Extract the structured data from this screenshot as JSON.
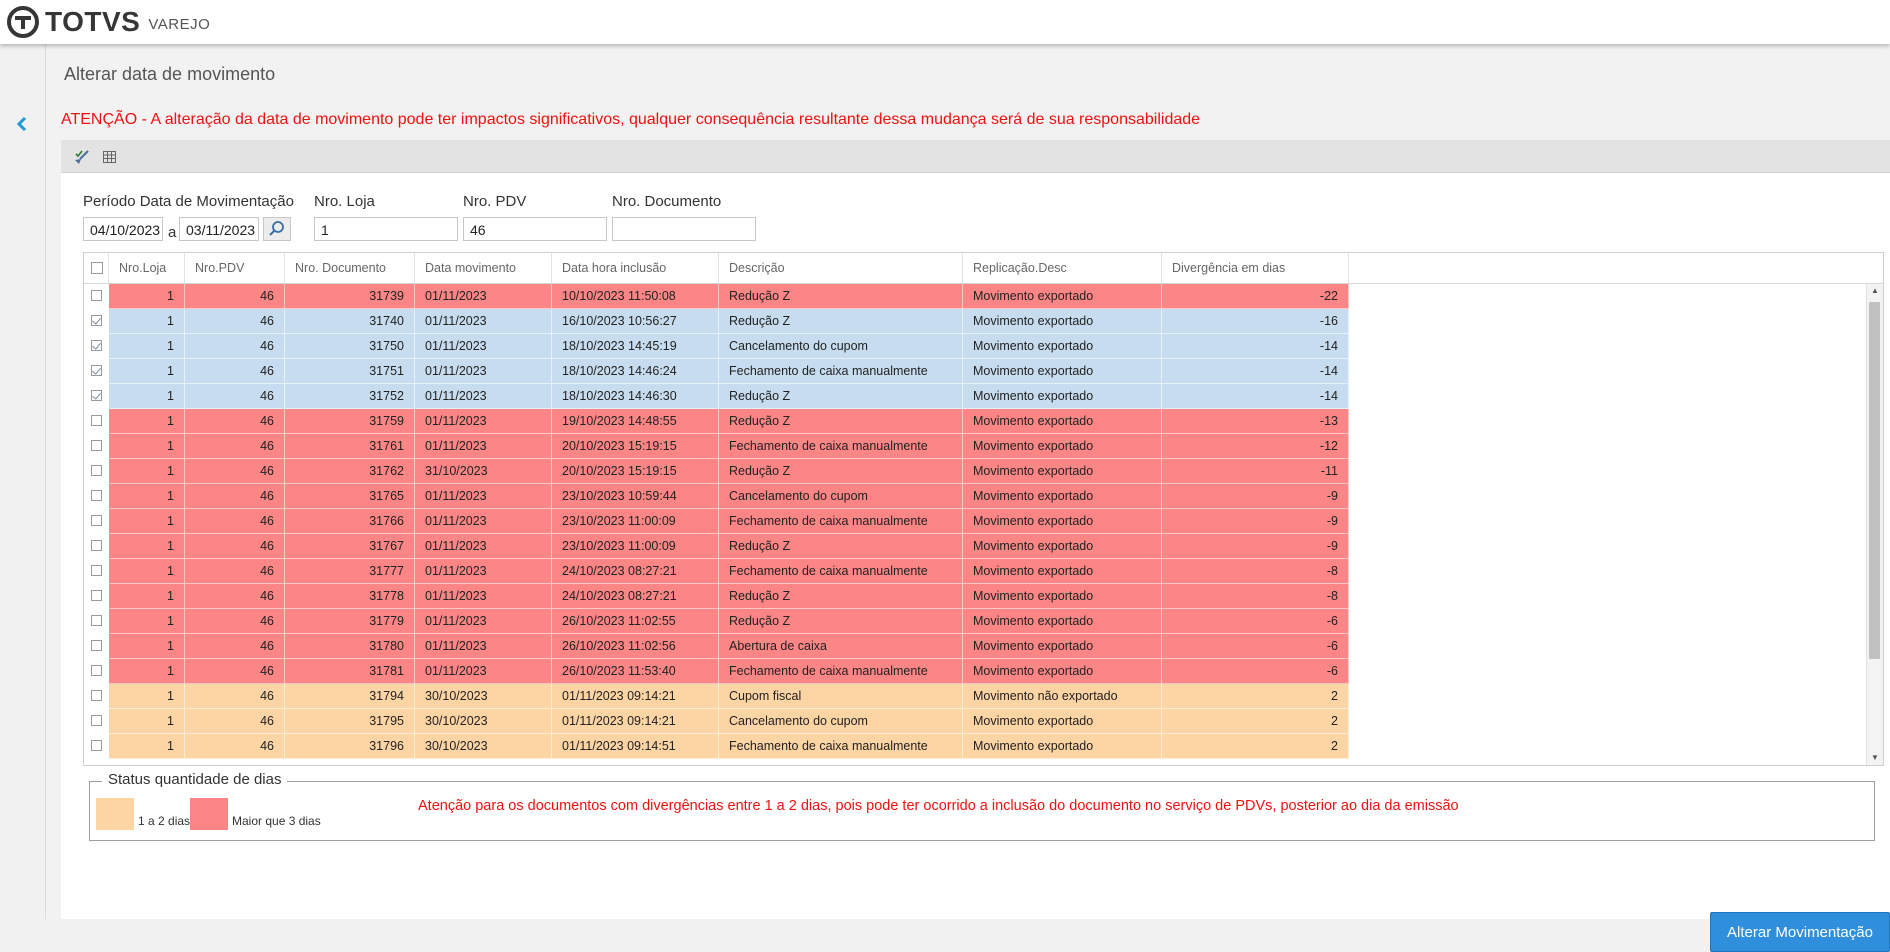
{
  "header": {
    "brand": "TOTVS",
    "product": "VAREJO"
  },
  "page": {
    "title": "Alterar data de movimento",
    "warning": "ATENÇÃO - A alteração da data de movimento pode ter impactos significativos, qualquer consequência resultante dessa mudança será de sua responsabilidade"
  },
  "filters": {
    "periodo_label": "Período Data de Movimentação",
    "data_inicio": "04/10/2023",
    "separator": "a",
    "data_fim": "03/11/2023",
    "loja_label": "Nro. Loja",
    "loja_value": "1",
    "pdv_label": "Nro. PDV",
    "pdv_value": "46",
    "documento_label": "Nro. Documento",
    "documento_value": ""
  },
  "colors": {
    "red": "#fc8585",
    "blue": "#c7ddef",
    "orange": "#fdd5a5",
    "warning": "#ee1111",
    "primary": "#2f8fdc"
  },
  "grid": {
    "columns": [
      {
        "key": "loja",
        "label": "Nro.Loja"
      },
      {
        "key": "pdv",
        "label": "Nro.PDV"
      },
      {
        "key": "doc",
        "label": "Nro. Documento"
      },
      {
        "key": "data",
        "label": "Data movimento"
      },
      {
        "key": "inclusao",
        "label": "Data hora inclusão"
      },
      {
        "key": "desc",
        "label": "Descrição"
      },
      {
        "key": "repl",
        "label": "Replicação.Desc"
      },
      {
        "key": "div",
        "label": "Divergência em dias"
      }
    ],
    "rows": [
      {
        "checked": false,
        "status": "red",
        "loja": "1",
        "pdv": "46",
        "doc": "31739",
        "data": "01/11/2023",
        "inclusao": "10/10/2023 11:50:08",
        "desc": "Redução Z",
        "repl": "Movimento exportado",
        "div": "-22"
      },
      {
        "checked": true,
        "status": "blue",
        "loja": "1",
        "pdv": "46",
        "doc": "31740",
        "data": "01/11/2023",
        "inclusao": "16/10/2023 10:56:27",
        "desc": "Redução Z",
        "repl": "Movimento exportado",
        "div": "-16"
      },
      {
        "checked": true,
        "status": "blue",
        "loja": "1",
        "pdv": "46",
        "doc": "31750",
        "data": "01/11/2023",
        "inclusao": "18/10/2023 14:45:19",
        "desc": "Cancelamento do cupom",
        "repl": "Movimento exportado",
        "div": "-14"
      },
      {
        "checked": true,
        "status": "blue",
        "loja": "1",
        "pdv": "46",
        "doc": "31751",
        "data": "01/11/2023",
        "inclusao": "18/10/2023 14:46:24",
        "desc": "Fechamento de caixa manualmente",
        "repl": "Movimento exportado",
        "div": "-14"
      },
      {
        "checked": true,
        "status": "blue",
        "loja": "1",
        "pdv": "46",
        "doc": "31752",
        "data": "01/11/2023",
        "inclusao": "18/10/2023 14:46:30",
        "desc": "Redução Z",
        "repl": "Movimento exportado",
        "div": "-14"
      },
      {
        "checked": false,
        "status": "red",
        "loja": "1",
        "pdv": "46",
        "doc": "31759",
        "data": "01/11/2023",
        "inclusao": "19/10/2023 14:48:55",
        "desc": "Redução Z",
        "repl": "Movimento exportado",
        "div": "-13"
      },
      {
        "checked": false,
        "status": "red",
        "loja": "1",
        "pdv": "46",
        "doc": "31761",
        "data": "01/11/2023",
        "inclusao": "20/10/2023 15:19:15",
        "desc": "Fechamento de caixa manualmente",
        "repl": "Movimento exportado",
        "div": "-12"
      },
      {
        "checked": false,
        "status": "red",
        "loja": "1",
        "pdv": "46",
        "doc": "31762",
        "data": "31/10/2023",
        "inclusao": "20/10/2023 15:19:15",
        "desc": "Redução Z",
        "repl": "Movimento exportado",
        "div": "-11"
      },
      {
        "checked": false,
        "status": "red",
        "loja": "1",
        "pdv": "46",
        "doc": "31765",
        "data": "01/11/2023",
        "inclusao": "23/10/2023 10:59:44",
        "desc": "Cancelamento do cupom",
        "repl": "Movimento exportado",
        "div": "-9"
      },
      {
        "checked": false,
        "status": "red",
        "loja": "1",
        "pdv": "46",
        "doc": "31766",
        "data": "01/11/2023",
        "inclusao": "23/10/2023 11:00:09",
        "desc": "Fechamento de caixa manualmente",
        "repl": "Movimento exportado",
        "div": "-9"
      },
      {
        "checked": false,
        "status": "red",
        "loja": "1",
        "pdv": "46",
        "doc": "31767",
        "data": "01/11/2023",
        "inclusao": "23/10/2023 11:00:09",
        "desc": "Redução Z",
        "repl": "Movimento exportado",
        "div": "-9"
      },
      {
        "checked": false,
        "status": "red",
        "loja": "1",
        "pdv": "46",
        "doc": "31777",
        "data": "01/11/2023",
        "inclusao": "24/10/2023 08:27:21",
        "desc": "Fechamento de caixa manualmente",
        "repl": "Movimento exportado",
        "div": "-8"
      },
      {
        "checked": false,
        "status": "red",
        "loja": "1",
        "pdv": "46",
        "doc": "31778",
        "data": "01/11/2023",
        "inclusao": "24/10/2023 08:27:21",
        "desc": "Redução Z",
        "repl": "Movimento exportado",
        "div": "-8"
      },
      {
        "checked": false,
        "status": "red",
        "loja": "1",
        "pdv": "46",
        "doc": "31779",
        "data": "01/11/2023",
        "inclusao": "26/10/2023 11:02:55",
        "desc": "Redução Z",
        "repl": "Movimento exportado",
        "div": "-6"
      },
      {
        "checked": false,
        "status": "red",
        "loja": "1",
        "pdv": "46",
        "doc": "31780",
        "data": "01/11/2023",
        "inclusao": "26/10/2023 11:02:56",
        "desc": "Abertura de caixa",
        "repl": "Movimento exportado",
        "div": "-6"
      },
      {
        "checked": false,
        "status": "red",
        "loja": "1",
        "pdv": "46",
        "doc": "31781",
        "data": "01/11/2023",
        "inclusao": "26/10/2023 11:53:40",
        "desc": "Fechamento de caixa manualmente",
        "repl": "Movimento exportado",
        "div": "-6"
      },
      {
        "checked": false,
        "status": "orange",
        "loja": "1",
        "pdv": "46",
        "doc": "31794",
        "data": "30/10/2023",
        "inclusao": "01/11/2023 09:14:21",
        "desc": "Cupom fiscal",
        "repl": "Movimento não exportado",
        "div": "2"
      },
      {
        "checked": false,
        "status": "orange",
        "loja": "1",
        "pdv": "46",
        "doc": "31795",
        "data": "30/10/2023",
        "inclusao": "01/11/2023 09:14:21",
        "desc": "Cancelamento do cupom",
        "repl": "Movimento exportado",
        "div": "2"
      },
      {
        "checked": false,
        "status": "orange",
        "loja": "1",
        "pdv": "46",
        "doc": "31796",
        "data": "30/10/2023",
        "inclusao": "01/11/2023 09:14:51",
        "desc": "Fechamento de caixa manualmente",
        "repl": "Movimento exportado",
        "div": "2"
      }
    ]
  },
  "legend": {
    "title": "Status quantidade de dias",
    "item1": "1 a 2 dias",
    "item2": "Maior que 3 dias",
    "note": "Atenção para os documentos com divergências entre 1 a 2 dias, pois pode ter ocorrido a inclusão do documento no serviço de PDVs, posterior ao dia da emissão"
  },
  "actions": {
    "alterar_label": "Alterar Movimentação"
  }
}
